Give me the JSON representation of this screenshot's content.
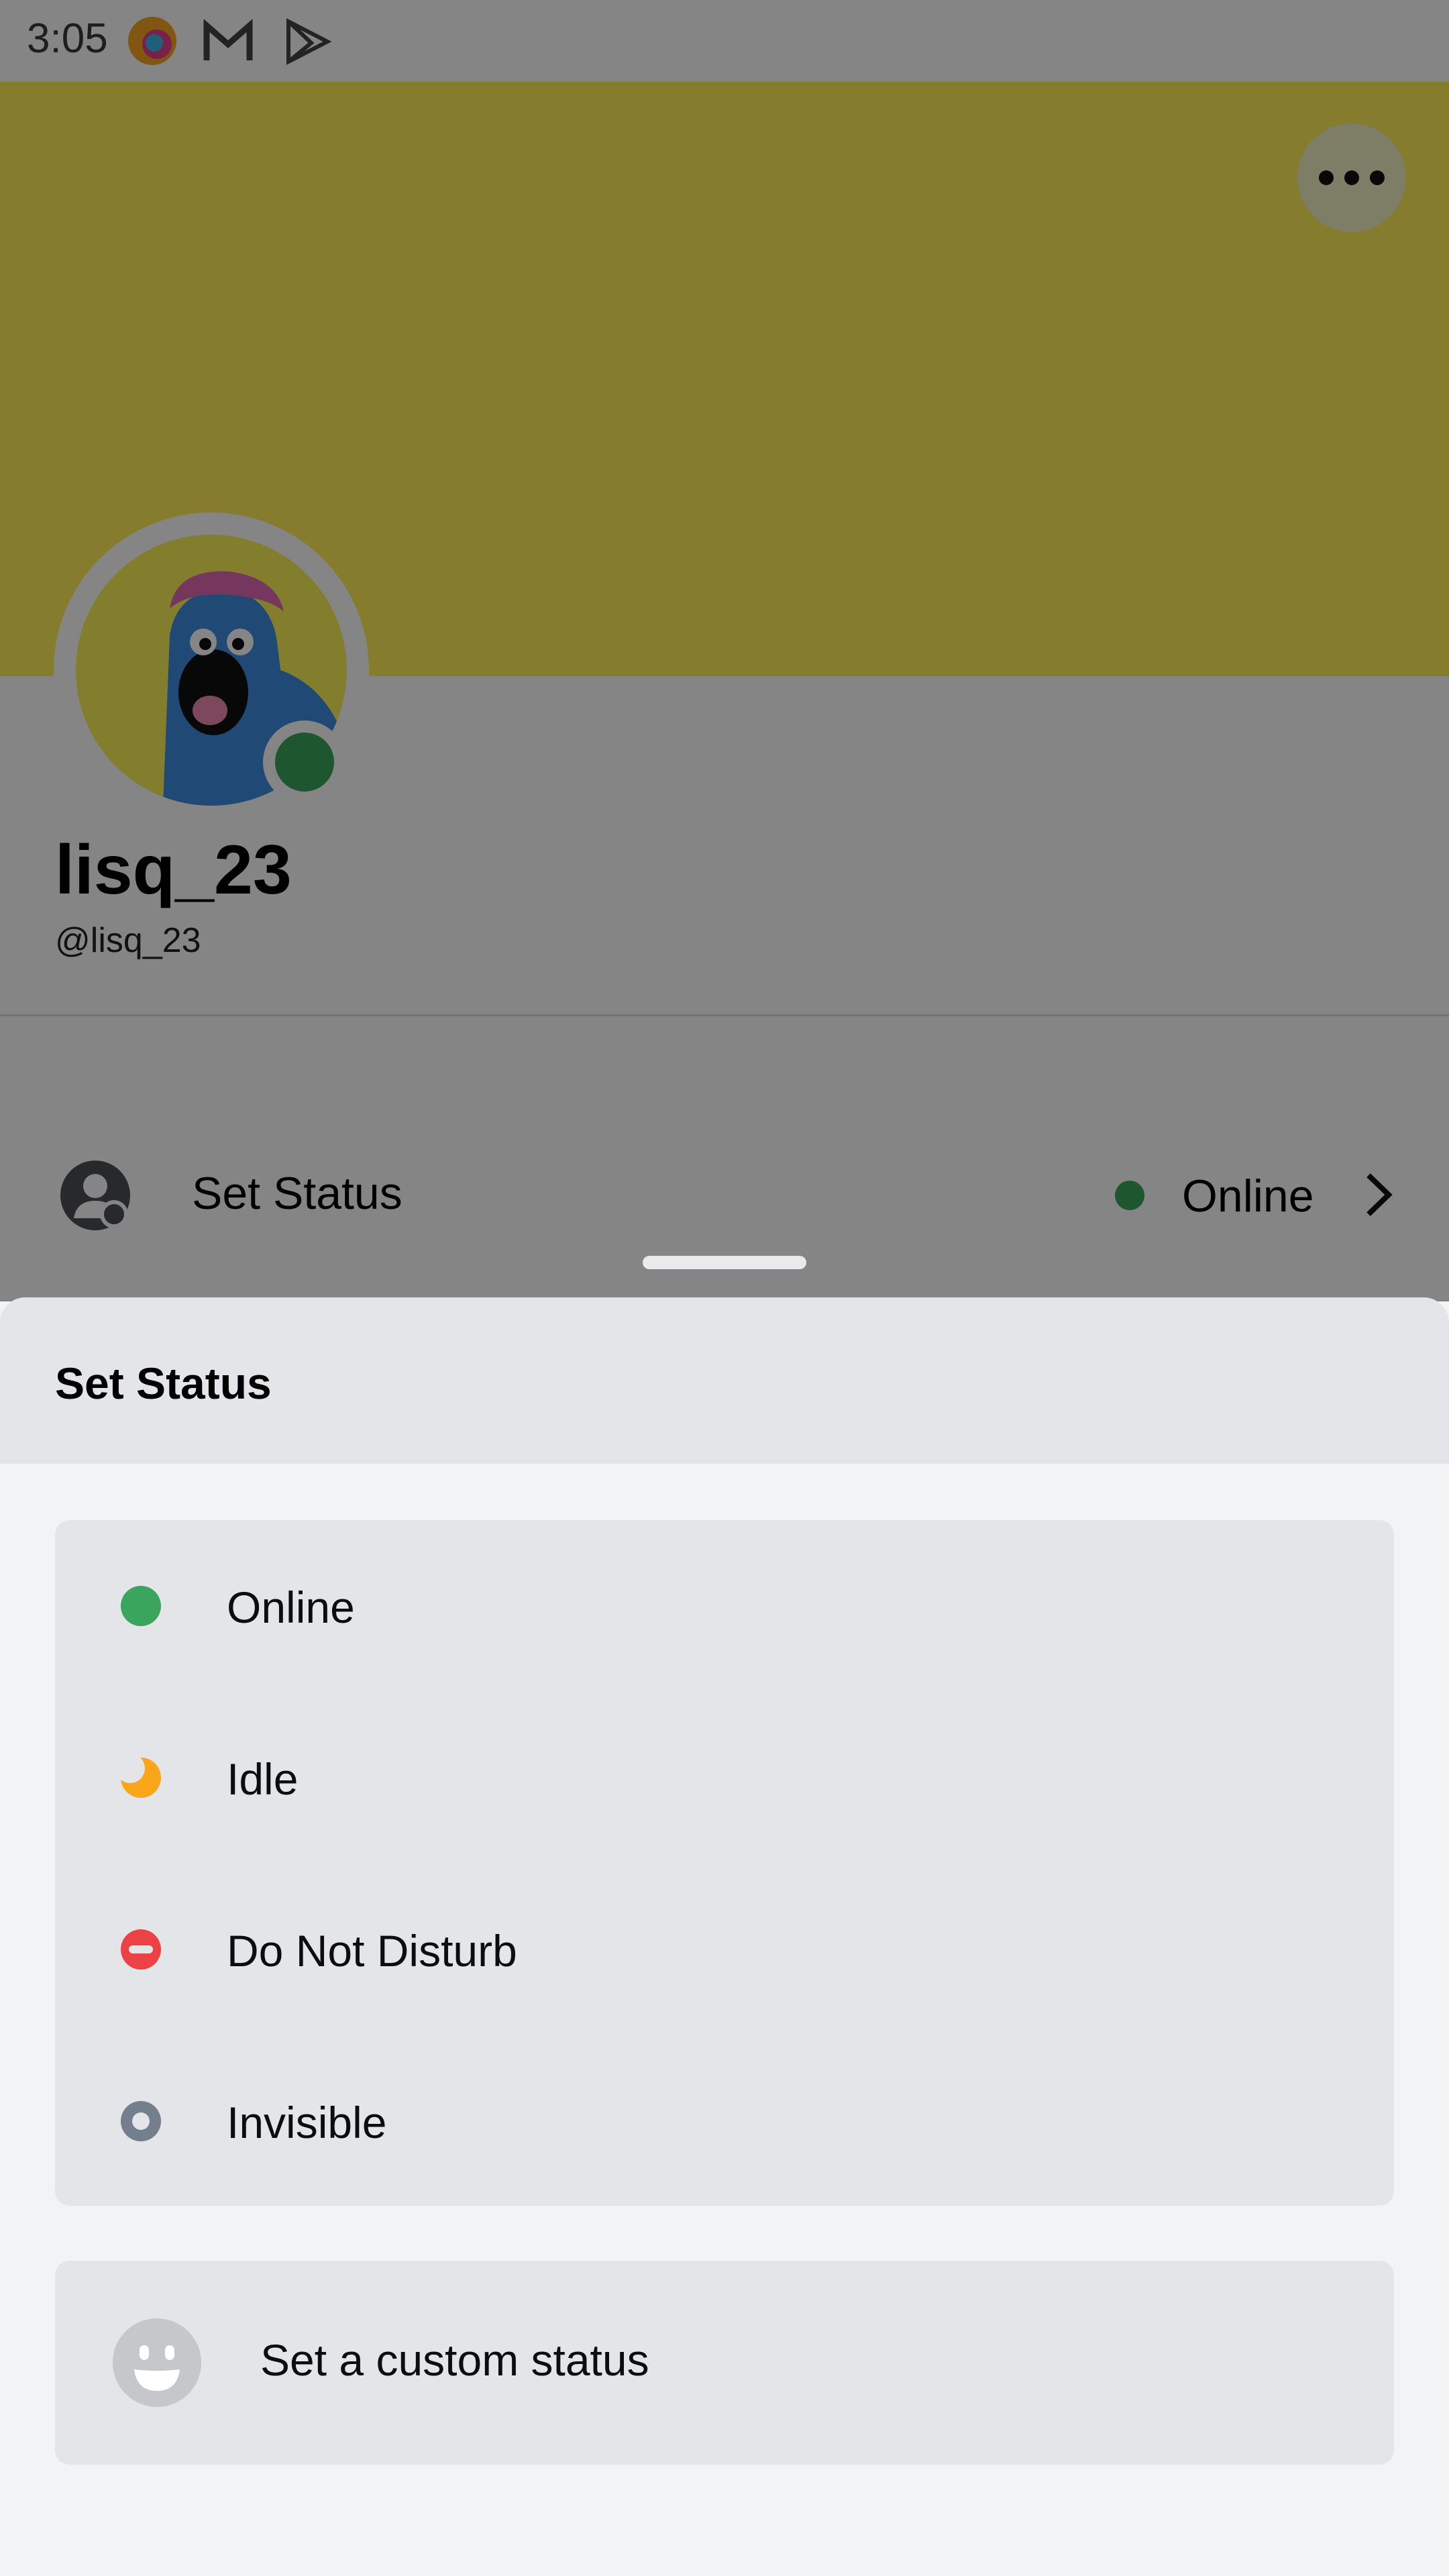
{
  "status_bar": {
    "time": "3:05"
  },
  "profile": {
    "display_name": "lisq_23",
    "handle": "@lisq_23",
    "banner_color": "#ffed58",
    "set_status_label": "Set Status",
    "current_status": "Online"
  },
  "sheet": {
    "title": "Set Status",
    "options": [
      {
        "label": "Online",
        "icon": "online-dot-icon",
        "color": "#3aa55d"
      },
      {
        "label": "Idle",
        "icon": "idle-moon-icon",
        "color": "#faa61a"
      },
      {
        "label": "Do Not Disturb",
        "icon": "dnd-icon",
        "color": "#ed4245"
      },
      {
        "label": "Invisible",
        "icon": "invisible-ring-icon",
        "color": "#747f8d"
      }
    ],
    "custom_status_label": "Set a custom status"
  }
}
